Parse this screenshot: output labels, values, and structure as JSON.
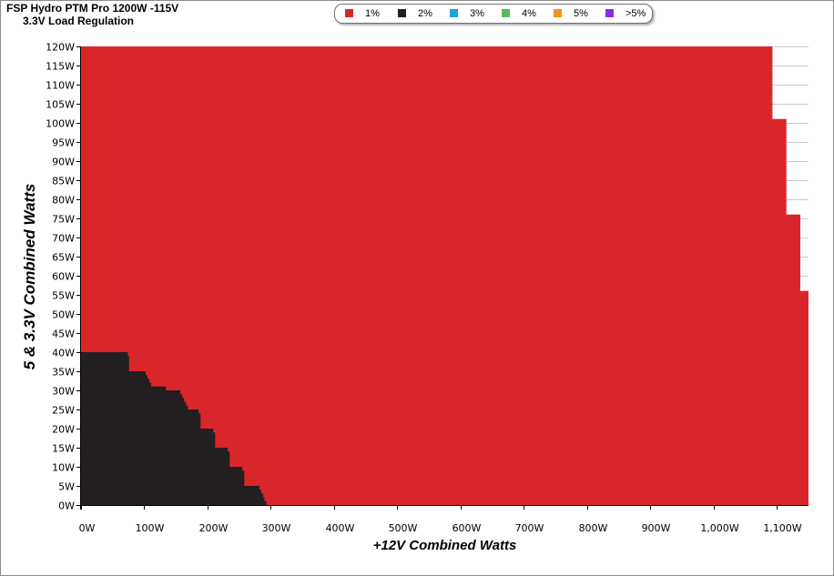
{
  "title": "FSP Hydro PTM Pro 1200W -115V",
  "subtitle": "3.3V Load Regulation",
  "legend": [
    {
      "label": "1%",
      "color": "#d9262a"
    },
    {
      "label": "2%",
      "color": "#231f20"
    },
    {
      "label": "3%",
      "color": "#1aa7d7"
    },
    {
      "label": "4%",
      "color": "#5cb85c"
    },
    {
      "label": "5%",
      "color": "#f0931e"
    },
    {
      "label": ">5%",
      "color": "#8a2be2"
    }
  ],
  "chart_data": {
    "type": "area",
    "title": "FSP Hydro PTM Pro 1200W -115V",
    "subtitle": "3.3V Load Regulation",
    "xlabel": "+12V Combined Watts",
    "ylabel": "5 & 3.3V Combined Watts",
    "xlim": [
      0,
      1150
    ],
    "ylim": [
      0,
      120
    ],
    "x_ticks": [
      {
        "value": 0,
        "label": "0W"
      },
      {
        "value": 100,
        "label": "100W"
      },
      {
        "value": 200,
        "label": "200W"
      },
      {
        "value": 300,
        "label": "300W"
      },
      {
        "value": 400,
        "label": "400W"
      },
      {
        "value": 500,
        "label": "500W"
      },
      {
        "value": 600,
        "label": "600W"
      },
      {
        "value": 700,
        "label": "700W"
      },
      {
        "value": 800,
        "label": "800W"
      },
      {
        "value": 900,
        "label": "900W"
      },
      {
        "value": 1000,
        "label": "1,000W"
      },
      {
        "value": 1100,
        "label": "1,100W"
      }
    ],
    "y_ticks": [
      {
        "value": 0,
        "label": "0W"
      },
      {
        "value": 5,
        "label": "5W"
      },
      {
        "value": 10,
        "label": "10W"
      },
      {
        "value": 15,
        "label": "15W"
      },
      {
        "value": 20,
        "label": "20W"
      },
      {
        "value": 25,
        "label": "25W"
      },
      {
        "value": 30,
        "label": "30W"
      },
      {
        "value": 35,
        "label": "35W"
      },
      {
        "value": 40,
        "label": "40W"
      },
      {
        "value": 45,
        "label": "45W"
      },
      {
        "value": 50,
        "label": "50W"
      },
      {
        "value": 55,
        "label": "55W"
      },
      {
        "value": 60,
        "label": "60W"
      },
      {
        "value": 65,
        "label": "65W"
      },
      {
        "value": 70,
        "label": "70W"
      },
      {
        "value": 75,
        "label": "75W"
      },
      {
        "value": 80,
        "label": "80W"
      },
      {
        "value": 85,
        "label": "85W"
      },
      {
        "value": 90,
        "label": "90W"
      },
      {
        "value": 95,
        "label": "95W"
      },
      {
        "value": 100,
        "label": "100W"
      },
      {
        "value": 105,
        "label": "105W"
      },
      {
        "value": 110,
        "label": "110W"
      },
      {
        "value": 115,
        "label": "115W"
      },
      {
        "value": 120,
        "label": "120W"
      }
    ],
    "grid": true,
    "legend_position": "top-center",
    "series": [
      {
        "name": "1%",
        "color": "#d9262a",
        "region_outline": [
          [
            0,
            -1
          ],
          [
            1160,
            -1
          ],
          [
            1160,
            56
          ],
          [
            1137,
            56
          ],
          [
            1137,
            76
          ],
          [
            1115,
            76
          ],
          [
            1115,
            101
          ],
          [
            1093,
            101
          ],
          [
            1093,
            121
          ],
          [
            0,
            121
          ]
        ]
      },
      {
        "name": "2%",
        "color": "#231f20",
        "region_outline": [
          [
            0,
            -1
          ],
          [
            295,
            -1
          ],
          [
            295,
            0
          ],
          [
            293,
            0
          ],
          [
            293,
            1
          ],
          [
            290,
            1
          ],
          [
            290,
            2
          ],
          [
            288,
            2
          ],
          [
            288,
            3
          ],
          [
            285,
            3
          ],
          [
            285,
            4
          ],
          [
            282,
            4
          ],
          [
            282,
            5
          ],
          [
            258,
            5
          ],
          [
            258,
            9
          ],
          [
            255,
            9
          ],
          [
            255,
            10
          ],
          [
            235,
            10
          ],
          [
            235,
            14
          ],
          [
            232,
            14
          ],
          [
            232,
            15
          ],
          [
            212,
            15
          ],
          [
            212,
            19
          ],
          [
            209,
            19
          ],
          [
            209,
            20
          ],
          [
            189,
            20
          ],
          [
            189,
            24
          ],
          [
            186,
            24
          ],
          [
            186,
            25
          ],
          [
            169,
            25
          ],
          [
            169,
            26
          ],
          [
            166,
            26
          ],
          [
            166,
            27
          ],
          [
            163,
            27
          ],
          [
            163,
            28
          ],
          [
            160,
            28
          ],
          [
            160,
            29
          ],
          [
            157,
            29
          ],
          [
            157,
            30
          ],
          [
            134,
            30
          ],
          [
            134,
            31
          ],
          [
            111,
            31
          ],
          [
            111,
            32
          ],
          [
            108,
            32
          ],
          [
            108,
            33
          ],
          [
            105,
            33
          ],
          [
            105,
            34
          ],
          [
            102,
            34
          ],
          [
            102,
            35
          ],
          [
            76,
            35
          ],
          [
            76,
            39
          ],
          [
            74,
            39
          ],
          [
            74,
            40
          ],
          [
            0,
            40
          ]
        ]
      }
    ]
  }
}
